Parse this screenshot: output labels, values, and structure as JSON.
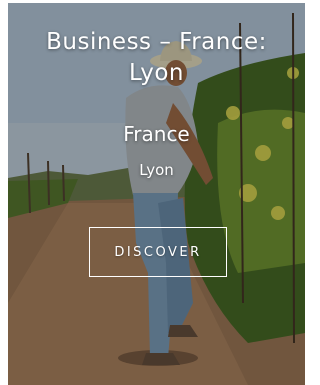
{
  "card": {
    "title": "Business – France: Lyon",
    "country": "France",
    "city": "Lyon",
    "button_label": "DISCOVER"
  },
  "colors": {
    "text": "#ffffff",
    "button_border": "#ffffff"
  }
}
